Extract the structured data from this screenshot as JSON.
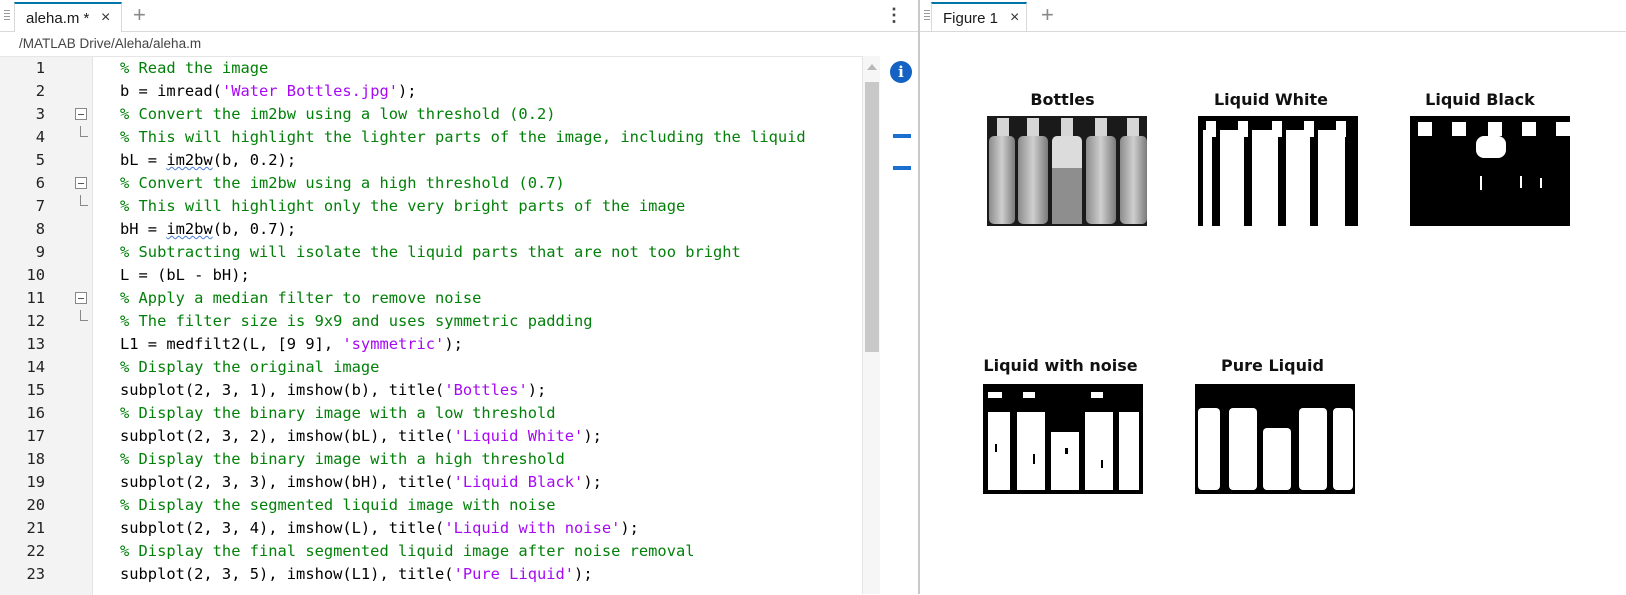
{
  "editor": {
    "tab_label": "aleha.m *",
    "path": "/MATLAB Drive/Aleha/aleha.m",
    "lines": [
      {
        "n": "1",
        "segments": [
          {
            "t": "% Read the image",
            "c": "comment"
          }
        ]
      },
      {
        "n": "2",
        "segments": [
          {
            "t": "b = imread(",
            "c": ""
          },
          {
            "t": "'Water Bottles.jpg'",
            "c": "str"
          },
          {
            "t": ");",
            "c": ""
          }
        ]
      },
      {
        "n": "3",
        "segments": [
          {
            "t": "% Convert the im2bw using a low threshold (0.2)",
            "c": "comment"
          }
        ]
      },
      {
        "n": "4",
        "segments": [
          {
            "t": "% This will highlight the lighter parts of the image, including the liquid",
            "c": "comment"
          }
        ]
      },
      {
        "n": "5",
        "segments": [
          {
            "t": "bL = ",
            "c": ""
          },
          {
            "t": "im2bw",
            "c": "squig"
          },
          {
            "t": "(b, 0.2);",
            "c": ""
          }
        ]
      },
      {
        "n": "6",
        "segments": [
          {
            "t": "% Convert the im2bw using a high threshold (0.7)",
            "c": "comment"
          }
        ]
      },
      {
        "n": "7",
        "segments": [
          {
            "t": "% This will highlight only the very bright parts of the image",
            "c": "comment"
          }
        ]
      },
      {
        "n": "8",
        "segments": [
          {
            "t": "bH = ",
            "c": ""
          },
          {
            "t": "im2bw",
            "c": "squig"
          },
          {
            "t": "(b, 0.7);",
            "c": ""
          }
        ]
      },
      {
        "n": "9",
        "segments": [
          {
            "t": "% Subtracting will isolate the liquid parts that are not too bright",
            "c": "comment"
          }
        ]
      },
      {
        "n": "10",
        "segments": [
          {
            "t": "L = (bL - bH);",
            "c": ""
          }
        ]
      },
      {
        "n": "11",
        "segments": [
          {
            "t": "% Apply a median filter to remove noise",
            "c": "comment"
          }
        ]
      },
      {
        "n": "12",
        "segments": [
          {
            "t": "% The filter size is 9x9 and uses symmetric padding",
            "c": "comment"
          }
        ]
      },
      {
        "n": "13",
        "segments": [
          {
            "t": "L1 = medfilt2(L, [9 9], ",
            "c": ""
          },
          {
            "t": "'symmetric'",
            "c": "str"
          },
          {
            "t": ");",
            "c": ""
          }
        ]
      },
      {
        "n": "14",
        "segments": [
          {
            "t": "% Display the original image",
            "c": "comment"
          }
        ]
      },
      {
        "n": "15",
        "segments": [
          {
            "t": "subplot(2, 3, 1), imshow(b), title(",
            "c": ""
          },
          {
            "t": "'Bottles'",
            "c": "str"
          },
          {
            "t": ");",
            "c": ""
          }
        ]
      },
      {
        "n": "16",
        "segments": [
          {
            "t": "% Display the binary image with a low threshold",
            "c": "comment"
          }
        ]
      },
      {
        "n": "17",
        "segments": [
          {
            "t": "subplot(2, 3, 2), imshow(bL), title(",
            "c": ""
          },
          {
            "t": "'Liquid White'",
            "c": "str"
          },
          {
            "t": ");",
            "c": ""
          }
        ]
      },
      {
        "n": "18",
        "segments": [
          {
            "t": "% Display the binary image with a high threshold",
            "c": "comment"
          }
        ]
      },
      {
        "n": "19",
        "segments": [
          {
            "t": "subplot(2, 3, 3), imshow(bH), title(",
            "c": ""
          },
          {
            "t": "'Liquid Black'",
            "c": "str"
          },
          {
            "t": ");",
            "c": ""
          }
        ]
      },
      {
        "n": "20",
        "segments": [
          {
            "t": "% Display the segmented liquid image with noise",
            "c": "comment"
          }
        ]
      },
      {
        "n": "21",
        "segments": [
          {
            "t": "subplot(2, 3, 4), imshow(L), title(",
            "c": ""
          },
          {
            "t": "'Liquid with noise'",
            "c": "str"
          },
          {
            "t": ");",
            "c": ""
          }
        ]
      },
      {
        "n": "22",
        "segments": [
          {
            "t": "% Display the final segmented liquid image after noise removal",
            "c": "comment"
          }
        ]
      },
      {
        "n": "23",
        "segments": [
          {
            "t": "subplot(2, 3, 5), imshow(L1), title(",
            "c": ""
          },
          {
            "t": "'Pure Liquid'",
            "c": "str"
          },
          {
            "t": ");",
            "c": ""
          }
        ]
      }
    ],
    "fold_lines": [
      "3",
      "6",
      "11"
    ]
  },
  "figure": {
    "tab_label": "Figure 1",
    "subplots": [
      {
        "title": "Bottles",
        "kind": "grayscale"
      },
      {
        "title": "Liquid White",
        "kind": "white"
      },
      {
        "title": "Liquid Black",
        "kind": "black"
      },
      {
        "title": "Liquid with noise",
        "kind": "noise"
      },
      {
        "title": "Pure Liquid",
        "kind": "pure"
      }
    ]
  },
  "icons": {
    "tab_close": "×",
    "tab_add": "+",
    "kebab": "⋮",
    "info": "i"
  },
  "colors": {
    "comment": "#028009",
    "string": "#a709f5",
    "accent": "#0076a8",
    "info": "#1462c4"
  }
}
